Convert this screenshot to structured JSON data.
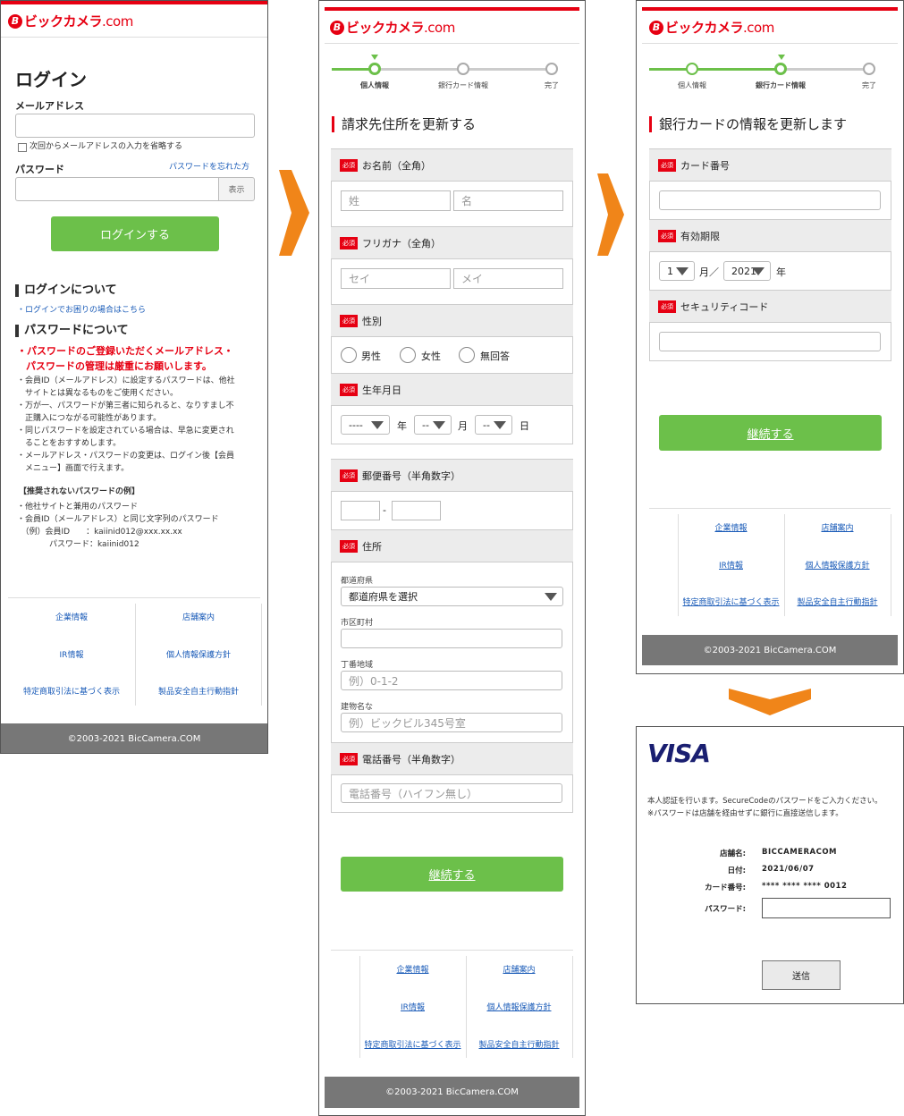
{
  "brand": {
    "logo_mark": "B",
    "logo_text": "ビックカメラ",
    "logo_suffix": ".com"
  },
  "login": {
    "title": "ログイン",
    "email_label": "メールアドレス",
    "remember_label": "次回からメールアドレスの入力を省略する",
    "password_label": "パスワード",
    "forgot_link": "パスワードを忘れた方",
    "show_button": "表示",
    "login_button": "ログインする",
    "about_login_heading": "ログインについて",
    "about_login_link": "・ログインでお困りの場合はこちら",
    "about_password_heading": "パスワードについて",
    "warning_line1": "・パスワードのご登録いただくメールアドレス・",
    "warning_line2": "パスワードの管理は厳重にお願いします。",
    "notes": [
      "・会員ID（メールアドレス）に設定するパスワードは、他社",
      "　サイトとは異なるものをご使用ください。",
      "・万が一、パスワードが第三者に知られると、なりすまし不",
      "　正購入につながる可能性があります。",
      "・同じパスワードを設定されている場合は、早急に変更され",
      "　ることをおすすめします。",
      "・メールアドレス・パスワードの変更は、ログイン後【会員",
      "　メニュー】画面で行えます。"
    ],
    "bad_example_heading": "【推奨されないパスワードの例】",
    "bad_examples": [
      "・他社サイトと兼用のパスワード",
      "・会員ID（メールアドレス）と同じ文字列のパスワード",
      "　（例）会員ID　　：kaiinid012@xxx.xx.xx",
      "　　　　パスワード：kaiinid012"
    ]
  },
  "footer": {
    "links": [
      "企業情報",
      "店舗案内",
      "IR情報",
      "個人情報保護方針",
      "特定商取引法に基づく表示",
      "製品安全自主行動指針"
    ],
    "copyright": "©2003-2021 BicCamera.COM"
  },
  "steps": [
    "個人情報",
    "銀行カード情報",
    "完了"
  ],
  "colors": {
    "brand_red": "#e60012",
    "green": "#6cc04a",
    "arrow_orange": "#f08519",
    "visa_blue": "#1a1f71"
  },
  "address_form": {
    "title": "請求先住所を更新する",
    "required_badge": "必須",
    "name_label": "お名前（全角）",
    "last_name_ph": "姓",
    "first_name_ph": "名",
    "kana_label": "フリガナ（全角）",
    "last_kana_ph": "セイ",
    "first_kana_ph": "メイ",
    "gender_label": "性別",
    "genders": [
      "男性",
      "女性",
      "無回答"
    ],
    "birth_label": "生年月日",
    "birth_year": "----",
    "birth_month": "--",
    "birth_day": "--",
    "year_unit": "年",
    "month_unit": "月",
    "day_unit": "日",
    "postal_label": "郵便番号（半角数字）",
    "postal_sep": "-",
    "address_label": "住所",
    "pref_label": "都道府県",
    "pref_value": "都道府県を選択",
    "city_label": "市区町村",
    "street_label": "丁番地域",
    "street_ph": "例）0-1-2",
    "building_label": "建物名な",
    "building_ph": "例）ビックビル345号室",
    "phone_label": "電話番号（半角数字）",
    "phone_ph": "電話番号（ハイフン無し）",
    "continue_button": "継続する"
  },
  "card_form": {
    "title": "銀行カードの情報を更新します",
    "card_label": "カード番号",
    "expiry_label": "有効期限",
    "expiry_month": "1",
    "month_sep": "月／",
    "expiry_year": "2021",
    "year_unit": "年",
    "cvc_label": "セキュリティコード",
    "continue_button": "継続する"
  },
  "visa": {
    "logo": "VISA",
    "intro1": "本人認証を行います。SecureCodeのパスワードをご入力ください。",
    "intro2": "※パスワードは店舗を経由せずに銀行に直接送信します。",
    "store_label": "店舗名:",
    "store_value": "BICCAMERACOM",
    "date_label": "日付:",
    "date_value": "2021/06/07",
    "card_label": "カード番号:",
    "card_value": "**** **** **** 0012",
    "password_label": "パスワード:",
    "submit_button": "送信"
  }
}
